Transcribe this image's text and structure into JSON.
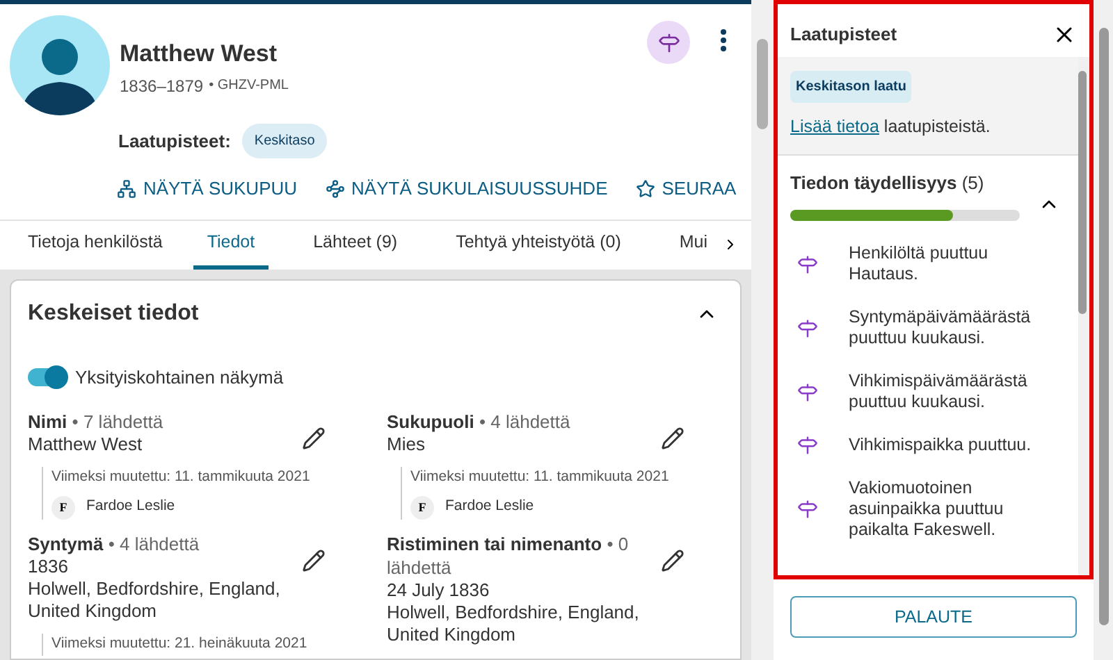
{
  "person": {
    "name": "Matthew West",
    "years": "1836–1879",
    "id": "• GHZV-PML",
    "quality_label": "Laatupisteet:",
    "quality_badge": "Keskitaso"
  },
  "actions": [
    {
      "kind": "tree",
      "label": "NÄYTÄ SUKUPUU"
    },
    {
      "kind": "relation",
      "label": "NÄYTÄ SUKULAISUUSSUHDE"
    },
    {
      "kind": "follow",
      "label": "SEURAA"
    }
  ],
  "tabs": [
    {
      "label": "Tietoja henkilöstä",
      "selected": false
    },
    {
      "label": "Tiedot",
      "selected": true
    },
    {
      "label": "Lähteet (9)",
      "selected": false
    },
    {
      "label": "Tehtyä yhteistyötä (0)",
      "selected": false
    },
    {
      "label": "Mui",
      "selected": false
    }
  ],
  "card": {
    "title": "Keskeiset tiedot",
    "toggle": {
      "label": "Yksityiskohtainen näkymä",
      "on": true
    },
    "fields": [
      {
        "label": "Nimi",
        "sources": "• 7 lähdettä",
        "lines": [
          "Matthew West"
        ],
        "changed": "Viimeksi muutettu: 11. tammikuuta 2021",
        "contributor_initial": "F",
        "contributor": "Fardoe Leslie"
      },
      {
        "label": "Sukupuoli",
        "sources": "• 4 lähdettä",
        "lines": [
          "Mies"
        ],
        "changed": "Viimeksi muutettu: 11. tammikuuta 2021",
        "contributor_initial": "F",
        "contributor": "Fardoe Leslie"
      },
      {
        "label": "Syntymä",
        "sources": "• 4 lähdettä",
        "lines": [
          "1836",
          "Holwell, Bedfordshire, England, United Kingdom"
        ],
        "changed": "Viimeksi muutettu: 21. heinäkuuta 2021"
      },
      {
        "label": "Ristiminen tai nimenanto",
        "sources": "• 0 lähdettä",
        "lines": [
          "24 July 1836",
          "Holwell, Bedfordshire, England, United Kingdom"
        ]
      }
    ]
  },
  "panel": {
    "title": "Laatupisteet",
    "badge": "Keskitason laatu",
    "info_link": "Lisää tietoa",
    "info_text": "laatupisteistä.",
    "section": {
      "title": "Tiedon täydellisyys",
      "count": "(5)",
      "expanded": true,
      "level": 0.71,
      "items": [
        "Henkilöltä puuttuu Hautaus.",
        "Syntymäpäivämäärästä puuttuu kuukausi.",
        "Vihkimispäivämäärästä puuttuu kuukausi.",
        "Vihkimispaikka puuttuu.",
        "Vakiomuotoinen asuinpaikka puuttuu paikalta Fakeswell."
      ]
    },
    "feedback_button": "PALAUTE"
  }
}
